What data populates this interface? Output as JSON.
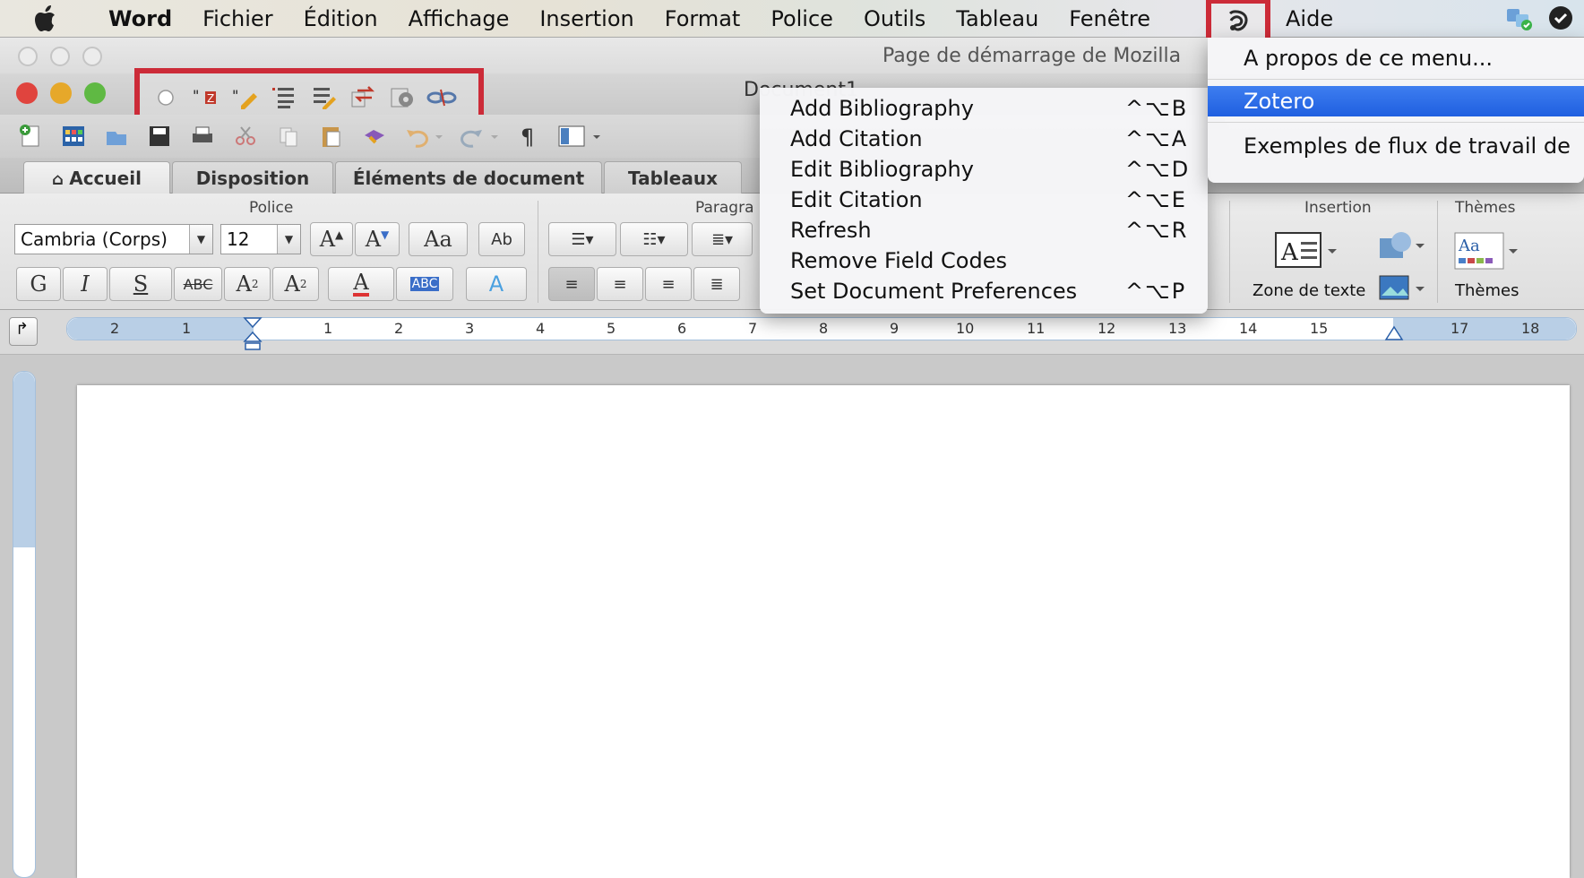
{
  "menubar": {
    "app_name": "Word",
    "items": [
      "Fichier",
      "Édition",
      "Affichage",
      "Insertion",
      "Format",
      "Police",
      "Outils",
      "Tableau",
      "Fenêtre"
    ],
    "aide": "Aide"
  },
  "window": {
    "browser_title": "Page de démarrage de Mozilla",
    "doc_title": "Document1"
  },
  "ribbon": {
    "tabs": [
      "Accueil",
      "Disposition",
      "Éléments de document",
      "Tableaux"
    ],
    "groups": {
      "police": "Police",
      "paragraphe": "Paragra",
      "insertion": "Insertion",
      "themes": "Thèmes"
    },
    "font_name": "Cambria (Corps)",
    "font_size": "12",
    "zone_texte_label": "Zone de texte",
    "themes_label": "Thèmes",
    "format_buttons": {
      "bold": "G",
      "italic": "I",
      "underline": "S",
      "strike": "ABC",
      "super": "A",
      "sub": "A",
      "color": "A"
    }
  },
  "ruler": {
    "marks": [
      "2",
      "1",
      "1",
      "2",
      "3",
      "4",
      "5",
      "6",
      "7",
      "8",
      "9",
      "10",
      "11",
      "12",
      "13",
      "14",
      "15",
      "17",
      "18"
    ]
  },
  "zotero_submenu": {
    "items": [
      {
        "label": "Add Bibliography",
        "shortcut": "^⌥B"
      },
      {
        "label": "Add Citation",
        "shortcut": "^⌥A"
      },
      {
        "label": "Edit Bibliography",
        "shortcut": "^⌥D"
      },
      {
        "label": "Edit Citation",
        "shortcut": "^⌥E"
      },
      {
        "label": "Refresh",
        "shortcut": "^⌥R"
      },
      {
        "label": "Remove Field Codes",
        "shortcut": ""
      },
      {
        "label": "Set Document Preferences",
        "shortcut": "^⌥P"
      }
    ]
  },
  "script_menu": {
    "about": "A propos de ce menu...",
    "zotero": "Zotero",
    "examples": "Exemples de flux de travail de"
  },
  "colors": {
    "highlight_border": "#cc2b38",
    "menu_selection": "#2a6ae8",
    "close": "#e0443e",
    "minimize": "#e6a82a",
    "zoom": "#5fb943"
  }
}
